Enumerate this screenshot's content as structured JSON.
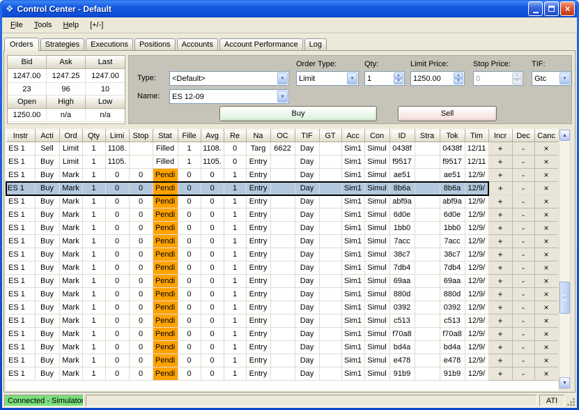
{
  "window": {
    "title": "Control Center - Default"
  },
  "menu": {
    "items": [
      "File",
      "Tools",
      "Help",
      "[+/-]"
    ]
  },
  "tabs": [
    "Orders",
    "Strategies",
    "Executions",
    "Positions",
    "Accounts",
    "Account Performance",
    "Log"
  ],
  "active_tab": "Orders",
  "market": {
    "top_headers": [
      "Bid",
      "Ask",
      "Last"
    ],
    "prices": [
      "1247.00",
      "1247.25",
      "1247.00"
    ],
    "sizes": [
      "23",
      "96",
      "10"
    ],
    "bottom_headers": [
      "Open",
      "High",
      "Low"
    ],
    "session": [
      "1250.00",
      "n/a",
      "n/a"
    ]
  },
  "order_entry": {
    "type_label": "Type:",
    "type_value": "<Default>",
    "name_label": "Name:",
    "name_value": "ES 12-09",
    "order_type_label": "Order Type:",
    "order_type_value": "Limit",
    "qty_label": "Qty:",
    "qty_value": "1",
    "limit_price_label": "Limit Price:",
    "limit_price_value": "1250.00",
    "stop_price_label": "Stop Price:",
    "stop_price_value": "0",
    "tif_label": "TIF:",
    "tif_value": "Gtc",
    "buy_label": "Buy",
    "sell_label": "Sell"
  },
  "grid": {
    "columns": [
      "Instr",
      "Acti",
      "Ord",
      "Qty",
      "Limi",
      "Stop",
      "Stat",
      "Fille",
      "Avg",
      "Re",
      "Na",
      "OC",
      "TIF",
      "GT",
      "Acc",
      "Con",
      "ID",
      "Stra",
      "Tok",
      "Tim",
      "Incr",
      "Dec",
      "Canc"
    ],
    "selected_row": 3,
    "rows": [
      [
        "ES 1",
        "Sell",
        "Limit",
        "1",
        "1108.",
        "",
        "Filled",
        "1",
        "1108.",
        "0",
        "Targ",
        "6622",
        "Day",
        "",
        "Sim1",
        "Simul",
        "0438f",
        "",
        "0438f",
        "12/11",
        "+",
        "-",
        "×"
      ],
      [
        "ES 1",
        "Buy",
        "Limit",
        "1",
        "1105.",
        "",
        "Filled",
        "1",
        "1105.",
        "0",
        "Entry",
        "",
        "Day",
        "",
        "Sim1",
        "Simul",
        "f9517",
        "",
        "f9517",
        "12/11",
        "+",
        "-",
        "×"
      ],
      [
        "ES 1",
        "Buy",
        "Mark",
        "1",
        "0",
        "0",
        "Pendi",
        "0",
        "0",
        "1",
        "Entry",
        "",
        "Day",
        "",
        "Sim1",
        "Simul",
        "ae51",
        "",
        "ae51",
        "12/9/",
        "+",
        "-",
        "×"
      ],
      [
        "ES 1",
        "Buy",
        "Mark",
        "1",
        "0",
        "0",
        "Pendi",
        "0",
        "0",
        "1",
        "Entry",
        "",
        "Day",
        "",
        "Sim1",
        "Simul",
        "8b6a",
        "",
        "8b6a",
        "12/9/",
        "+",
        "-",
        "×"
      ],
      [
        "ES 1",
        "Buy",
        "Mark",
        "1",
        "0",
        "0",
        "Pendi",
        "0",
        "0",
        "1",
        "Entry",
        "",
        "Day",
        "",
        "Sim1",
        "Simul",
        "abf9a",
        "",
        "abf9a",
        "12/9/",
        "+",
        "-",
        "×"
      ],
      [
        "ES 1",
        "Buy",
        "Mark",
        "1",
        "0",
        "0",
        "Pendi",
        "0",
        "0",
        "1",
        "Entry",
        "",
        "Day",
        "",
        "Sim1",
        "Simul",
        "6d0e",
        "",
        "6d0e",
        "12/9/",
        "+",
        "-",
        "×"
      ],
      [
        "ES 1",
        "Buy",
        "Mark",
        "1",
        "0",
        "0",
        "Pendi",
        "0",
        "0",
        "1",
        "Entry",
        "",
        "Day",
        "",
        "Sim1",
        "Simul",
        "1bb0",
        "",
        "1bb0",
        "12/9/",
        "+",
        "-",
        "×"
      ],
      [
        "ES 1",
        "Buy",
        "Mark",
        "1",
        "0",
        "0",
        "Pendi",
        "0",
        "0",
        "1",
        "Entry",
        "",
        "Day",
        "",
        "Sim1",
        "Simul",
        "7acc",
        "",
        "7acc",
        "12/9/",
        "+",
        "-",
        "×"
      ],
      [
        "ES 1",
        "Buy",
        "Mark",
        "1",
        "0",
        "0",
        "Pendi",
        "0",
        "0",
        "1",
        "Entry",
        "",
        "Day",
        "",
        "Sim1",
        "Simul",
        "38c7",
        "",
        "38c7",
        "12/9/",
        "+",
        "-",
        "×"
      ],
      [
        "ES 1",
        "Buy",
        "Mark",
        "1",
        "0",
        "0",
        "Pendi",
        "0",
        "0",
        "1",
        "Entry",
        "",
        "Day",
        "",
        "Sim1",
        "Simul",
        "7db4",
        "",
        "7db4",
        "12/9/",
        "+",
        "-",
        "×"
      ],
      [
        "ES 1",
        "Buy",
        "Mark",
        "1",
        "0",
        "0",
        "Pendi",
        "0",
        "0",
        "1",
        "Entry",
        "",
        "Day",
        "",
        "Sim1",
        "Simul",
        "69aa",
        "",
        "69aa",
        "12/9/",
        "+",
        "-",
        "×"
      ],
      [
        "ES 1",
        "Buy",
        "Mark",
        "1",
        "0",
        "0",
        "Pendi",
        "0",
        "0",
        "1",
        "Entry",
        "",
        "Day",
        "",
        "Sim1",
        "Simul",
        "880d",
        "",
        "880d",
        "12/9/",
        "+",
        "-",
        "×"
      ],
      [
        "ES 1",
        "Buy",
        "Mark",
        "1",
        "0",
        "0",
        "Pendi",
        "0",
        "0",
        "1",
        "Entry",
        "",
        "Day",
        "",
        "Sim1",
        "Simul",
        "0392",
        "",
        "0392",
        "12/9/",
        "+",
        "-",
        "×"
      ],
      [
        "ES 1",
        "Buy",
        "Mark",
        "1",
        "0",
        "0",
        "Pendi",
        "0",
        "0",
        "1",
        "Entry",
        "",
        "Day",
        "",
        "Sim1",
        "Simul",
        "c513",
        "",
        "c513",
        "12/9/",
        "+",
        "-",
        "×"
      ],
      [
        "ES 1",
        "Buy",
        "Mark",
        "1",
        "0",
        "0",
        "Pendi",
        "0",
        "0",
        "1",
        "Entry",
        "",
        "Day",
        "",
        "Sim1",
        "Simul",
        "f70a8",
        "",
        "f70a8",
        "12/9/",
        "+",
        "-",
        "×"
      ],
      [
        "ES 1",
        "Buy",
        "Mark",
        "1",
        "0",
        "0",
        "Pendi",
        "0",
        "0",
        "1",
        "Entry",
        "",
        "Day",
        "",
        "Sim1",
        "Simul",
        "bd4a",
        "",
        "bd4a",
        "12/9/",
        "+",
        "-",
        "×"
      ],
      [
        "ES 1",
        "Buy",
        "Mark",
        "1",
        "0",
        "0",
        "Pendi",
        "0",
        "0",
        "1",
        "Entry",
        "",
        "Day",
        "",
        "Sim1",
        "Simul",
        "e478",
        "",
        "e478",
        "12/9/",
        "+",
        "-",
        "×"
      ],
      [
        "ES 1",
        "Buy",
        "Mark",
        "1",
        "0",
        "0",
        "Pendi",
        "0",
        "0",
        "1",
        "Entry",
        "",
        "Day",
        "",
        "Sim1",
        "Simul",
        "91b9",
        "",
        "91b9",
        "12/9/",
        "+",
        "-",
        "×"
      ]
    ]
  },
  "status_bar": {
    "connection": "Connected - Simulator",
    "ati_label": "ATI"
  },
  "colors": {
    "titlebar_blue": "#0A55E0",
    "pending_bg": "#FFA200",
    "selected_row_bg": "#B3C8DE",
    "connected_bg": "#7BDF7B",
    "buy_button_bg": "#EAF7EA",
    "sell_button_bg": "#FBE9E9"
  }
}
